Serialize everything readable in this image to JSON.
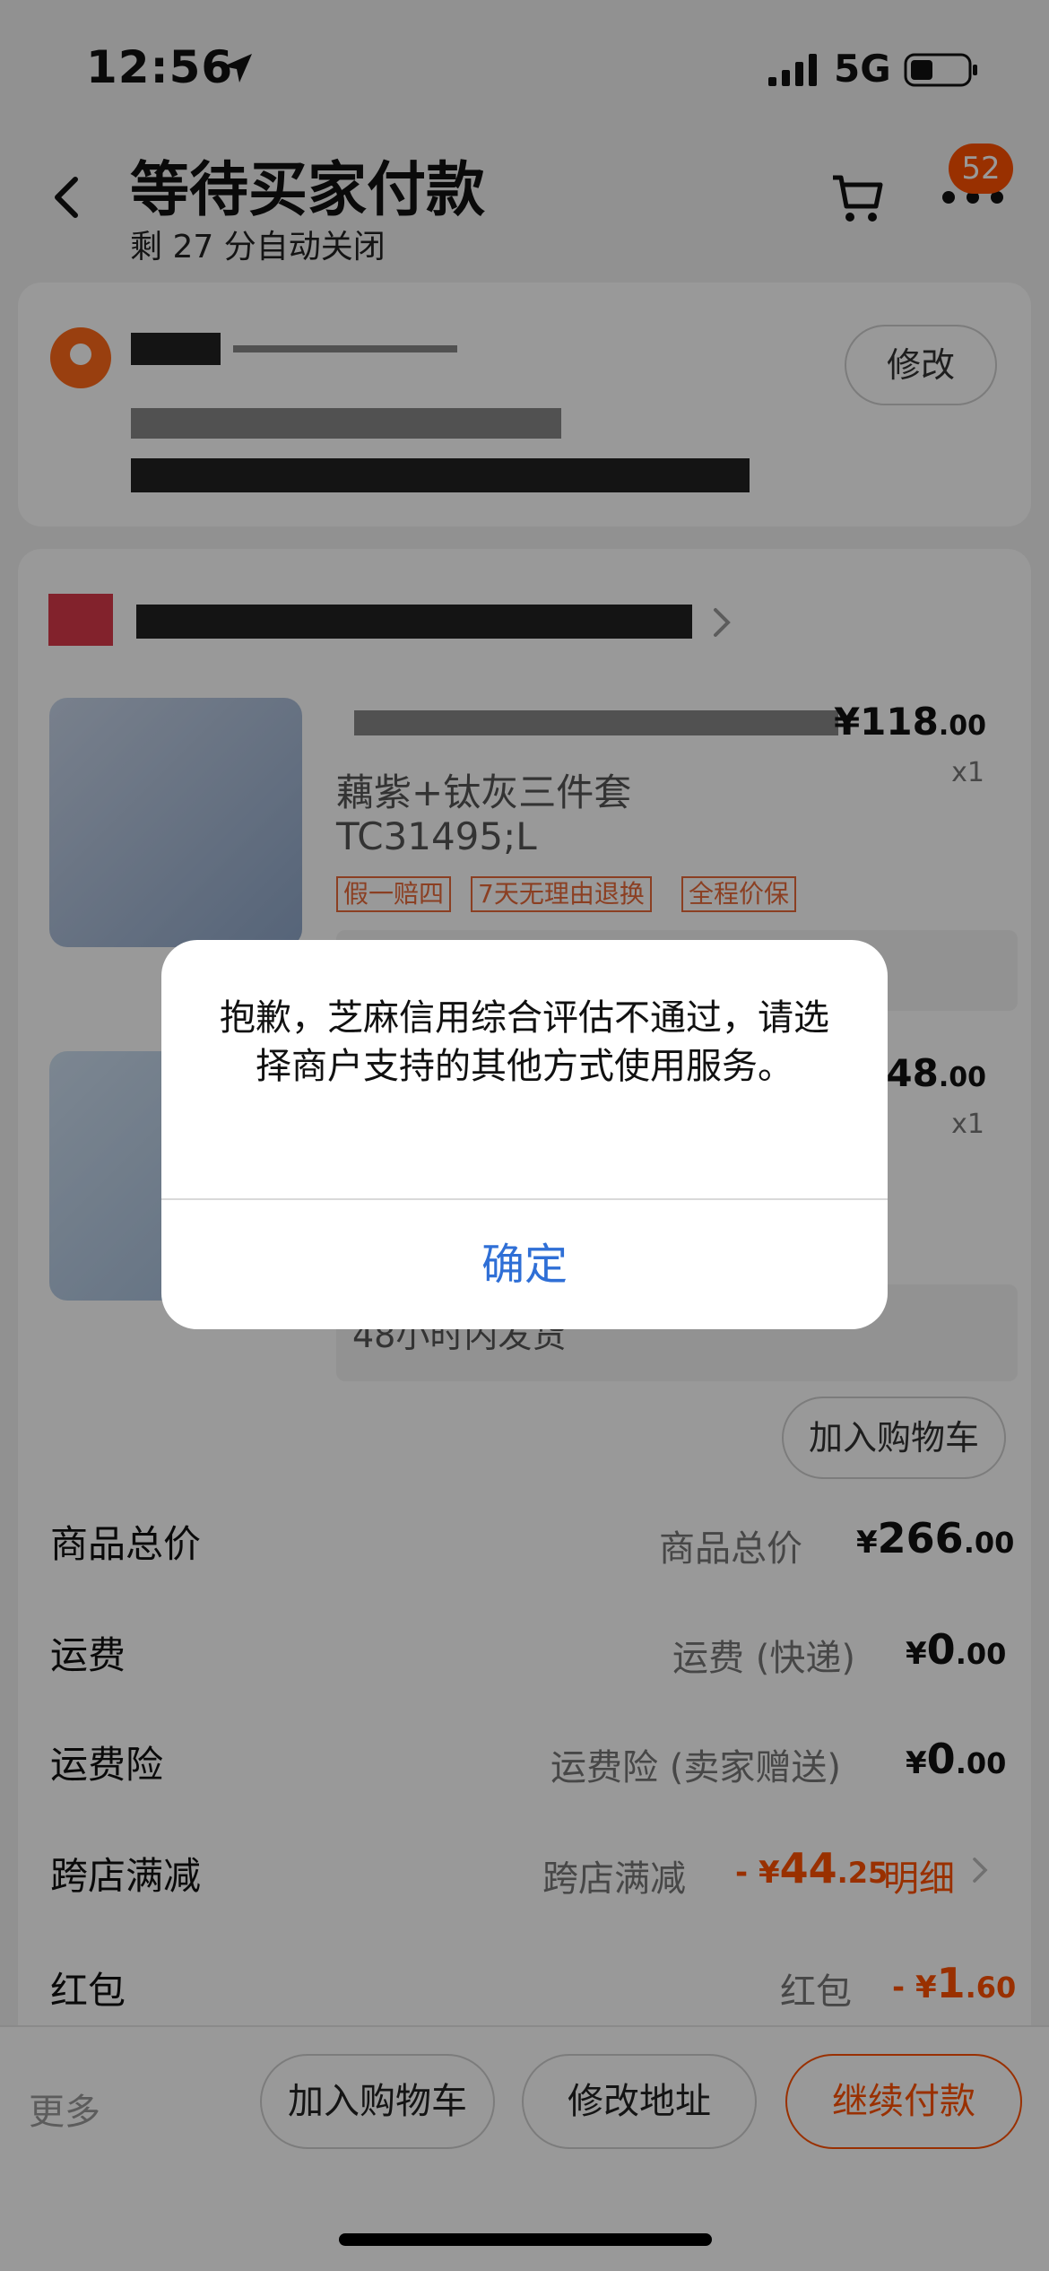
{
  "status_bar": {
    "time": "12:56",
    "network": "5G"
  },
  "header": {
    "title": "等待买家付款",
    "subtitle": "剩 27 分自动关闭",
    "cart_badge": "52"
  },
  "address": {
    "edit_label": "修改"
  },
  "products": [
    {
      "price_int": "118",
      "price_dec": ".00",
      "qty": "x1",
      "spec_line1": "藕紫+钛灰三件套",
      "spec_line2": "TC31495;L",
      "tags": [
        "假一赔四",
        "7天无理由退换",
        "全程价保"
      ]
    },
    {
      "price_int": "148",
      "price_dec": ".00",
      "qty": "x1",
      "ship_note": "48小时内发货"
    }
  ],
  "add_to_cart_small": "加入购物车",
  "summary": [
    {
      "label": "商品总价",
      "mid": "商品总价",
      "currency": "¥",
      "int": "266",
      "dec": ".00"
    },
    {
      "label": "运费",
      "mid": "运费 (快递)",
      "currency": "¥",
      "int": "0",
      "dec": ".00"
    },
    {
      "label": "运费险",
      "mid": "运费险 (卖家赠送)",
      "currency": "¥",
      "int": "0",
      "dec": ".00"
    },
    {
      "label": "跨店满减",
      "mid": "跨店满减",
      "currency": "- ¥",
      "int": "44",
      "dec": ".25",
      "detail": "明细"
    },
    {
      "label": "红包",
      "mid": "红包",
      "currency": "- ¥",
      "int": "1",
      "dec": ".60"
    }
  ],
  "bottom_bar": {
    "more": "更多",
    "add_cart": "加入购物车",
    "edit_address": "修改地址",
    "continue_pay": "继续付款"
  },
  "alert": {
    "message": "抱歉，芝麻信用综合评估不通过，请选择商户支持的其他方式使用服务。",
    "confirm": "确定"
  },
  "colors": {
    "accent": "#ff5000",
    "link": "#2f6fd6"
  }
}
